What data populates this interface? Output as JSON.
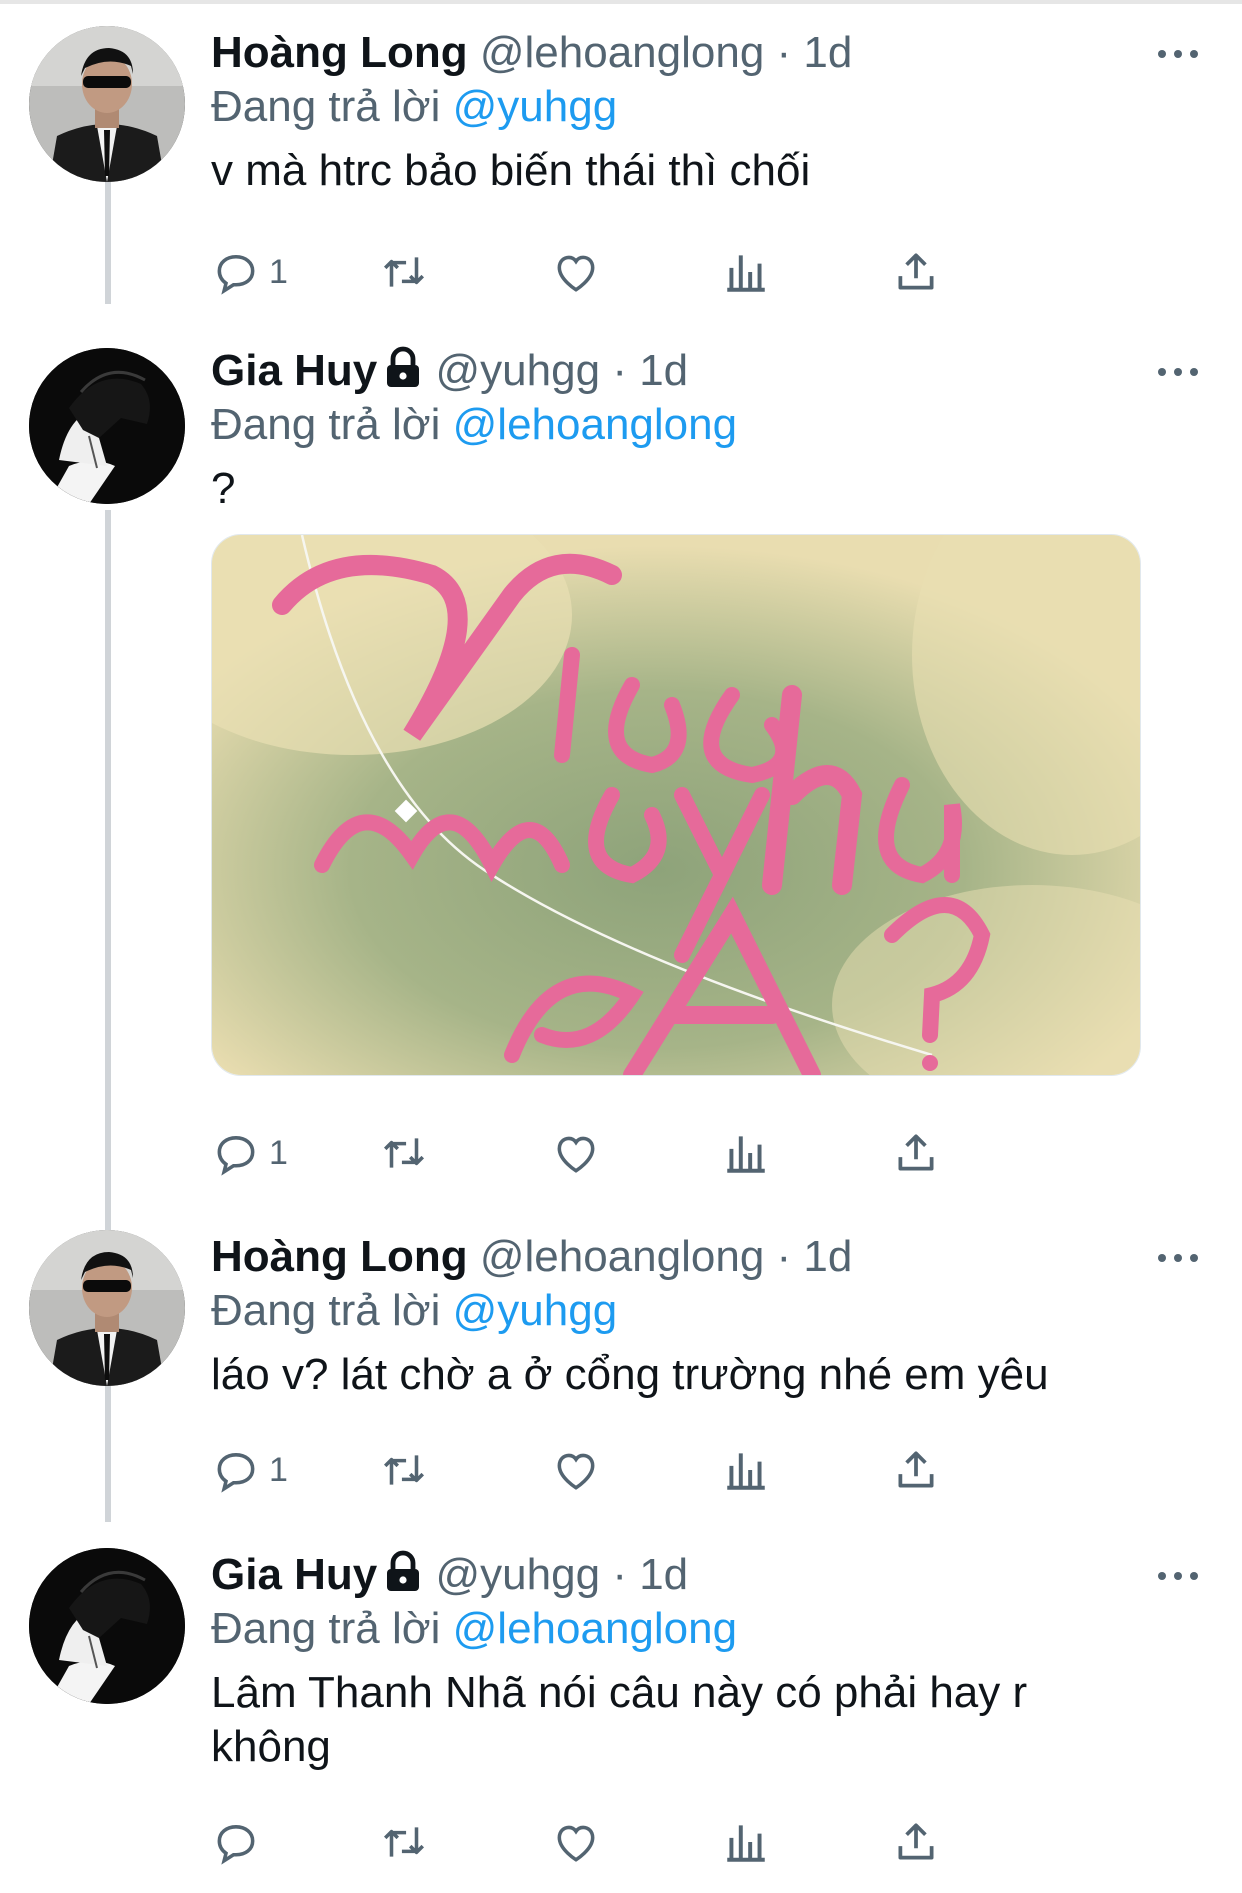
{
  "tweets": [
    {
      "name": "Hoàng Long",
      "handle": "@lehoanglong",
      "dot": "·",
      "time": "1d",
      "reply_prefix": "Đang trả lời",
      "reply_mention": "@yuhgg",
      "text": "v mà htrc bảo biến thái thì chối",
      "reply_count": "1",
      "protected": false,
      "avatar": "avatar-man-sunglasses"
    },
    {
      "name": "Gia Huy",
      "handle": "@yuhgg",
      "dot": "·",
      "time": "1d",
      "reply_prefix": "Đang trả lời",
      "reply_mention": "@lehoanglong",
      "text": "?",
      "reply_count": "1",
      "protected": true,
      "avatar": "avatar-anime-boy",
      "media": "image-viec-may-nha-a"
    },
    {
      "name": "Hoàng Long",
      "handle": "@lehoanglong",
      "dot": "·",
      "time": "1d",
      "reply_prefix": "Đang trả lời",
      "reply_mention": "@yuhgg",
      "text": "láo v? lát chờ a ở cổng trường nhé em yêu",
      "reply_count": "1",
      "protected": false,
      "avatar": "avatar-man-sunglasses"
    },
    {
      "name": "Gia Huy",
      "handle": "@yuhgg",
      "dot": "·",
      "time": "1d",
      "reply_prefix": "Đang trả lời",
      "reply_mention": "@lehoanglong",
      "text": "Lâm Thanh Nhã nói câu này có phải hay r không",
      "reply_count": "",
      "protected": true,
      "avatar": "avatar-anime-boy"
    }
  ],
  "icons": {
    "reply": "reply-icon",
    "retweet": "retweet-icon",
    "like": "heart-icon",
    "views": "views-icon",
    "share": "share-icon",
    "more": "more-icon",
    "lock": "lock-icon"
  },
  "colors": {
    "accent": "#1d9bf0",
    "secondary_text": "#536471",
    "primary_text": "#0f1419",
    "thread_line": "#d0d4d8",
    "media_pink": "#e66a9a",
    "media_green": "#8ea37a",
    "media_cream": "#e9ddb0"
  }
}
